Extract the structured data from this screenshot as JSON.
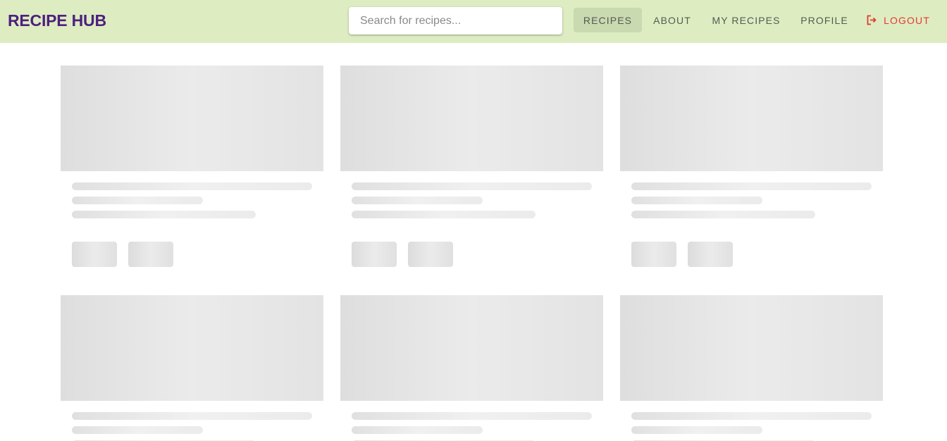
{
  "app": {
    "title": "RECIPE HUB",
    "brand_color": "#4e1f7f",
    "header_color": "#ddedc1"
  },
  "search": {
    "placeholder": "Search for recipes...",
    "value": ""
  },
  "nav": {
    "recipes": "RECIPES",
    "about": "ABOUT",
    "my_recipes": "MY RECIPES",
    "profile": "PROFILE",
    "logout": "LOGOUT",
    "logout_icon": "logout-icon",
    "logout_color": "#e53935",
    "active": "RECIPES"
  },
  "content": {
    "state": "loading",
    "skeleton_cards": 6
  }
}
